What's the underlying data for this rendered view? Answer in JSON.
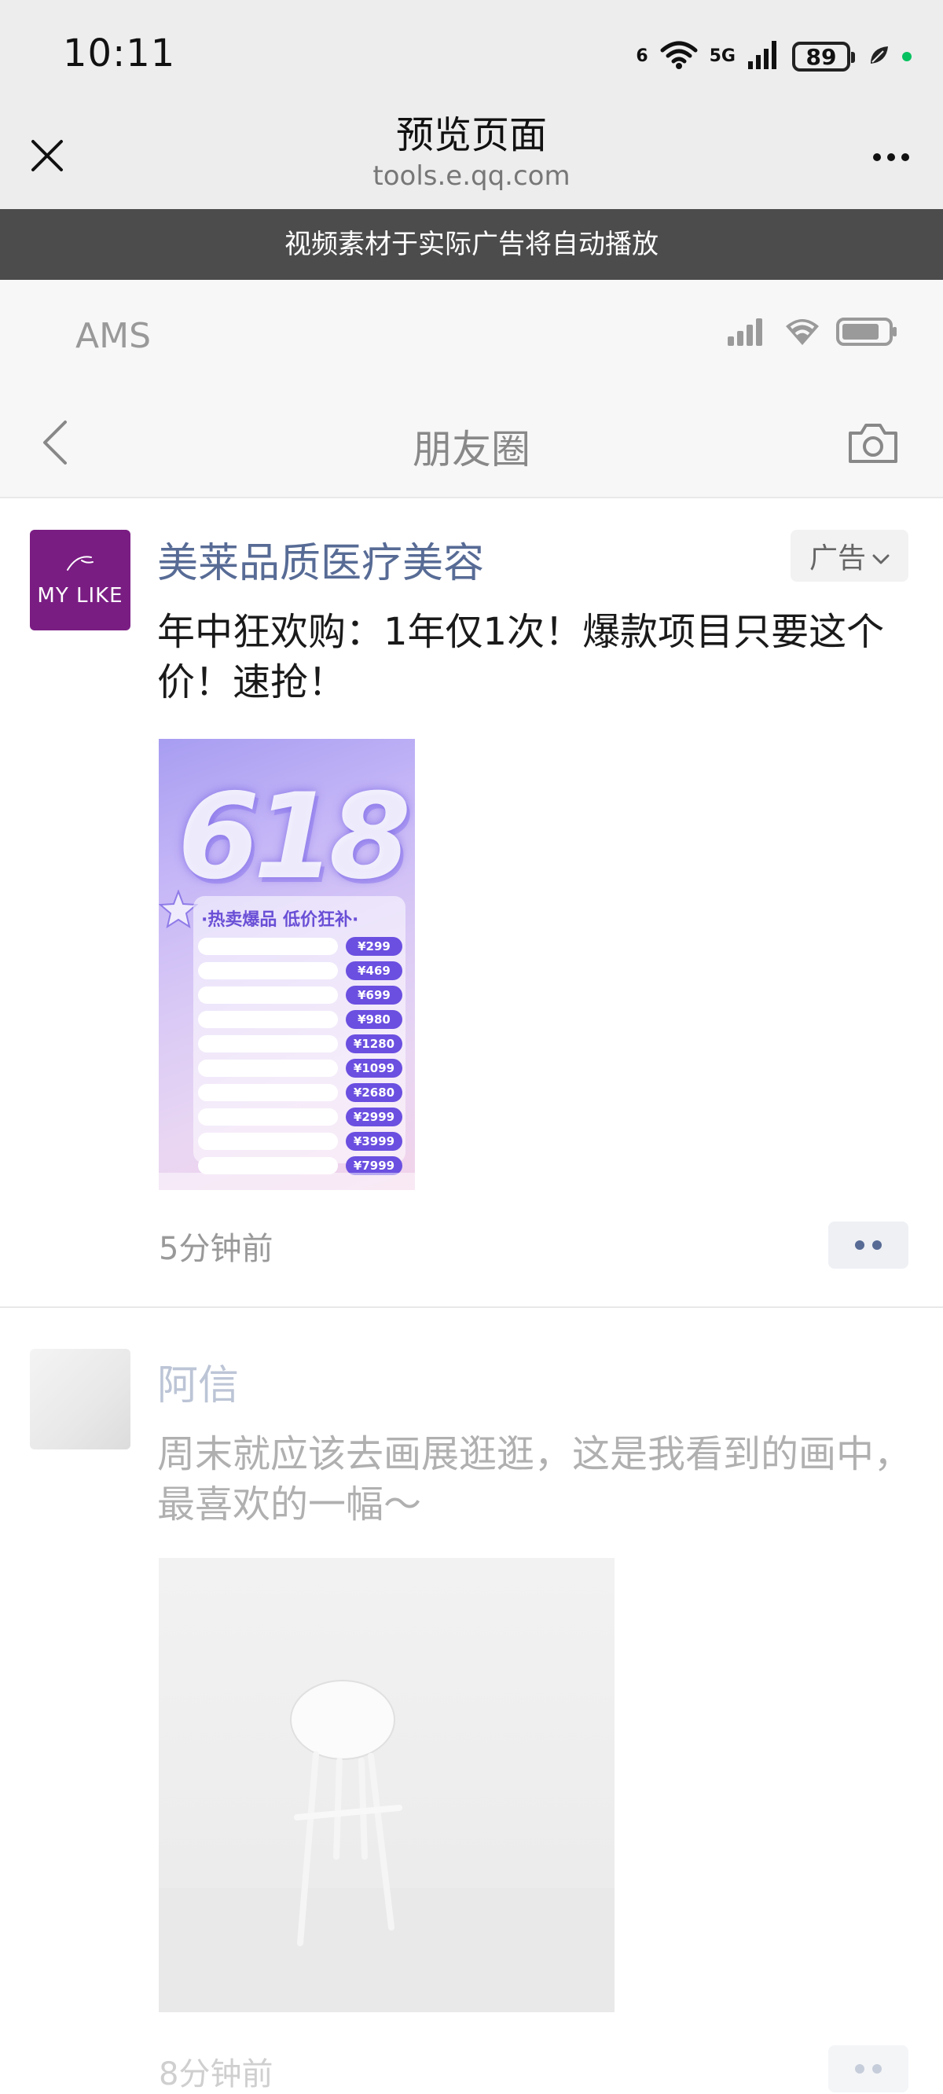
{
  "status_bar": {
    "time": "10:11",
    "network_1": "6",
    "network_2": "5G",
    "battery": "89"
  },
  "browser": {
    "title": "预览页面",
    "url": "tools.e.qq.com"
  },
  "notice": "视频素材于实际广告将自动播放",
  "preview_status": {
    "carrier": "AMS"
  },
  "moments": {
    "title": "朋友圈"
  },
  "ad_post": {
    "author": "美莱品质医疗美容",
    "avatar_logo": "MY LIKE",
    "ad_tag": "广告",
    "text": "年中狂欢购：1年仅1次！爆款项目只要这个价！速抢！",
    "time": "5分钟前",
    "poster": {
      "big_text": "618",
      "header": "·热卖爆品 低价狂补·",
      "prices": [
        "¥299",
        "¥469",
        "¥699",
        "¥980",
        "¥1280",
        "¥1099",
        "¥2680",
        "¥2999",
        "¥3999",
        "¥7999"
      ]
    }
  },
  "sample_post": {
    "author": "阿信",
    "text": "周末就应该去画展逛逛，这是我看到的画中，最喜欢的一幅～",
    "time": "8分钟前"
  }
}
